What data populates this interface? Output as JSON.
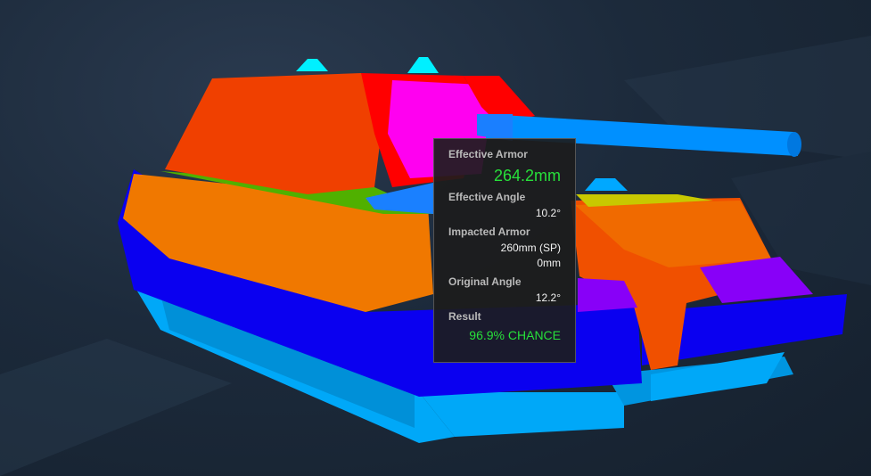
{
  "scene": {
    "subject": "tank armor model",
    "colors": {
      "turret_front": "#f04000",
      "turret_red": "#ff0000",
      "turret_magenta": "#ff00f0",
      "hull_orange": "#f07800",
      "hull_blue": "#0000ff",
      "track_blue": "#00a0f0",
      "gun_blue": "#0090ff",
      "purple": "#8000ff",
      "cyan": "#00f0ff",
      "green": "#50b000"
    }
  },
  "tooltip": {
    "effective_armor_label": "Effective Armor",
    "effective_armor_value": "264.2mm",
    "effective_angle_label": "Effective Angle",
    "effective_angle_value": "10.2°",
    "impacted_armor_label": "Impacted Armor",
    "impacted_armor_value": "260mm (SP)",
    "impacted_armor_extra": "0mm",
    "original_angle_label": "Original Angle",
    "original_angle_value": "12.2°",
    "result_label": "Result",
    "result_value": "96.9% CHANCE",
    "accent_color": "#27e03a"
  }
}
